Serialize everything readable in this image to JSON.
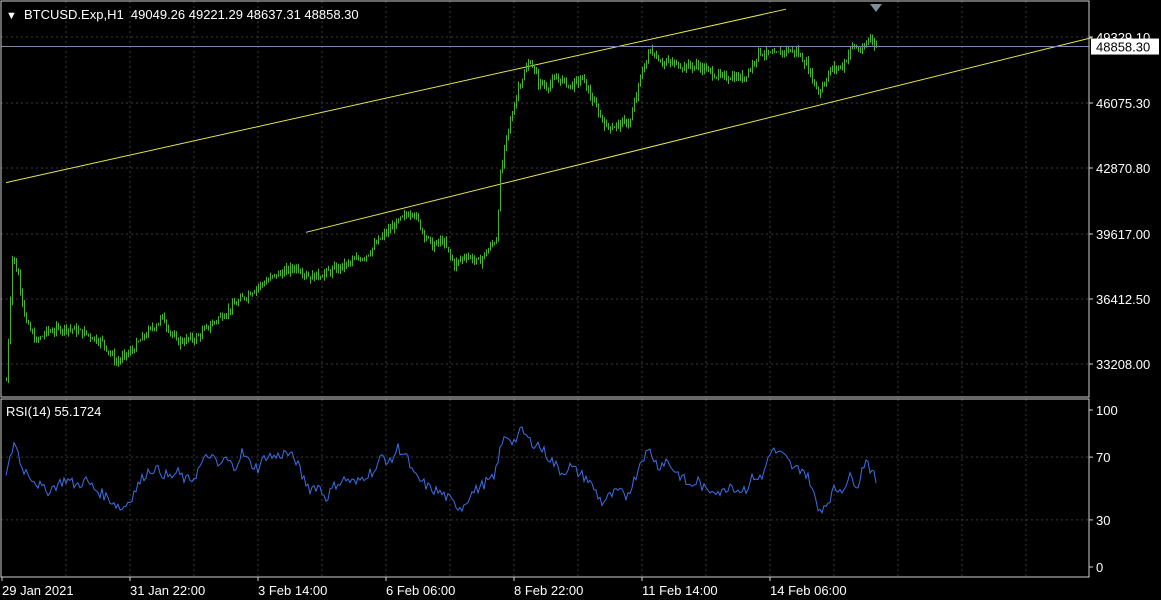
{
  "symbol_header": {
    "menu_glyph": "▼",
    "label": "BTCUSD.Exp,H1  49049.26 49221.29 48637.31 48858.30"
  },
  "indicator_header": {
    "label": "RSI(14) 55.1724"
  },
  "colors": {
    "background": "#000000",
    "grid": "#3a3a3a",
    "candle": "#4caf32",
    "channel": "#e6e64a",
    "rsi_line": "#3d6fe8",
    "price_line": "#7a8aa8",
    "current_price_box_bg": "#ffffff",
    "current_price_box_text": "#000000",
    "text": "#ffffff"
  },
  "chart_data": [
    {
      "type": "candlestick",
      "title": "BTCUSD.Exp,H1",
      "timeframe": "H1",
      "x_tick_labels": [
        "29 Jan 2021",
        "31 Jan 22:00",
        "3 Feb 14:00",
        "6 Feb 06:00",
        "8 Feb 22:00",
        "11 Feb 14:00",
        "14 Feb 06:00"
      ],
      "y_tick_labels": [
        "33208.00",
        "36412.50",
        "39617.00",
        "42870.80",
        "46075.30",
        "49329.10"
      ],
      "y_ticks": [
        33208.0,
        36412.5,
        39617.0,
        42870.8,
        46075.3,
        49329.1
      ],
      "ylim": [
        32000,
        50500
      ],
      "last_bar": {
        "open": 49049.26,
        "high": 49221.29,
        "low": 48637.31,
        "close": 48858.3
      },
      "current_price": 48858.3,
      "current_price_label": "48858.30",
      "close_path": [
        [
          0,
          32400
        ],
        [
          3,
          38500
        ],
        [
          6,
          37600
        ],
        [
          10,
          35200
        ],
        [
          15,
          34300
        ],
        [
          20,
          34800
        ],
        [
          30,
          35000
        ],
        [
          40,
          34700
        ],
        [
          48,
          34300
        ],
        [
          55,
          33300
        ],
        [
          62,
          33800
        ],
        [
          70,
          34700
        ],
        [
          78,
          35500
        ],
        [
          85,
          34300
        ],
        [
          95,
          34500
        ],
        [
          105,
          35400
        ],
        [
          115,
          36200
        ],
        [
          125,
          37000
        ],
        [
          135,
          37600
        ],
        [
          145,
          38000
        ],
        [
          152,
          37500
        ],
        [
          160,
          37700
        ],
        [
          170,
          38100
        ],
        [
          180,
          38600
        ],
        [
          190,
          39700
        ],
        [
          197,
          40300
        ],
        [
          203,
          40800
        ],
        [
          208,
          39800
        ],
        [
          213,
          39000
        ],
        [
          218,
          39300
        ],
        [
          224,
          38100
        ],
        [
          230,
          38600
        ],
        [
          236,
          38200
        ],
        [
          242,
          39000
        ],
        [
          245,
          39400
        ],
        [
          247,
          42500
        ],
        [
          250,
          44300
        ],
        [
          256,
          46900
        ],
        [
          262,
          48200
        ],
        [
          266,
          47100
        ],
        [
          270,
          46900
        ],
        [
          276,
          47300
        ],
        [
          282,
          46900
        ],
        [
          288,
          47300
        ],
        [
          294,
          46000
        ],
        [
          300,
          44900
        ],
        [
          306,
          45000
        ],
        [
          312,
          45200
        ],
        [
          318,
          47700
        ],
        [
          322,
          48700
        ],
        [
          328,
          48100
        ],
        [
          334,
          48000
        ],
        [
          340,
          47900
        ],
        [
          346,
          47900
        ],
        [
          352,
          47600
        ],
        [
          358,
          47300
        ],
        [
          362,
          47400
        ],
        [
          368,
          47300
        ],
        [
          372,
          47800
        ],
        [
          376,
          48600
        ],
        [
          384,
          48400
        ],
        [
          390,
          48700
        ],
        [
          395,
          48600
        ],
        [
          400,
          48000
        ],
        [
          406,
          46600
        ],
        [
          412,
          47700
        ],
        [
          418,
          47900
        ],
        [
          423,
          48900
        ],
        [
          428,
          48600
        ],
        [
          432,
          49400
        ],
        [
          435,
          48860
        ]
      ],
      "channel_lines": [
        {
          "name": "upper",
          "start": [
            0,
            42150
          ],
          "end": [
            390,
            50700
          ]
        },
        {
          "name": "lower",
          "start": [
            150,
            39700
          ],
          "end": [
            543,
            49300
          ]
        }
      ]
    },
    {
      "type": "line",
      "title": "RSI(14)",
      "series": [
        {
          "name": "RSI(14)",
          "last_value": 55.1724
        }
      ],
      "y_tick_labels": [
        "100",
        "70",
        "30",
        "0"
      ],
      "y_ticks": [
        100,
        70,
        30,
        0
      ],
      "levels": [
        70,
        30
      ],
      "ylim": [
        0,
        100
      ],
      "rsi_path": [
        [
          0,
          57
        ],
        [
          2,
          68
        ],
        [
          4,
          80
        ],
        [
          6,
          73
        ],
        [
          8,
          63
        ],
        [
          11,
          60
        ],
        [
          15,
          54
        ],
        [
          20,
          48
        ],
        [
          25,
          52
        ],
        [
          30,
          56
        ],
        [
          35,
          52
        ],
        [
          40,
          55
        ],
        [
          45,
          49
        ],
        [
          50,
          45
        ],
        [
          55,
          40
        ],
        [
          58,
          37
        ],
        [
          62,
          43
        ],
        [
          66,
          52
        ],
        [
          70,
          60
        ],
        [
          74,
          63
        ],
        [
          78,
          60
        ],
        [
          82,
          57
        ],
        [
          86,
          60
        ],
        [
          90,
          55
        ],
        [
          94,
          57
        ],
        [
          98,
          66
        ],
        [
          102,
          72
        ],
        [
          106,
          64
        ],
        [
          110,
          69
        ],
        [
          114,
          63
        ],
        [
          118,
          73
        ],
        [
          122,
          66
        ],
        [
          126,
          63
        ],
        [
          130,
          71
        ],
        [
          135,
          70
        ],
        [
          140,
          73
        ],
        [
          145,
          68
        ],
        [
          148,
          58
        ],
        [
          152,
          50
        ],
        [
          156,
          52
        ],
        [
          160,
          44
        ],
        [
          165,
          53
        ],
        [
          170,
          56
        ],
        [
          175,
          53
        ],
        [
          180,
          59
        ],
        [
          185,
          62
        ],
        [
          188,
          71
        ],
        [
          192,
          66
        ],
        [
          196,
          76
        ],
        [
          200,
          71
        ],
        [
          204,
          58
        ],
        [
          208,
          54
        ],
        [
          212,
          50
        ],
        [
          216,
          48
        ],
        [
          220,
          45
        ],
        [
          224,
          40
        ],
        [
          228,
          38
        ],
        [
          232,
          46
        ],
        [
          236,
          50
        ],
        [
          240,
          54
        ],
        [
          244,
          56
        ],
        [
          246,
          69
        ],
        [
          248,
          78
        ],
        [
          250,
          84
        ],
        [
          254,
          80
        ],
        [
          258,
          87
        ],
        [
          262,
          80
        ],
        [
          266,
          78
        ],
        [
          270,
          72
        ],
        [
          274,
          66
        ],
        [
          278,
          60
        ],
        [
          282,
          64
        ],
        [
          286,
          60
        ],
        [
          290,
          57
        ],
        [
          294,
          50
        ],
        [
          298,
          41
        ],
        [
          302,
          45
        ],
        [
          306,
          48
        ],
        [
          310,
          45
        ],
        [
          314,
          55
        ],
        [
          318,
          70
        ],
        [
          322,
          74
        ],
        [
          326,
          64
        ],
        [
          330,
          68
        ],
        [
          334,
          62
        ],
        [
          338,
          57
        ],
        [
          342,
          51
        ],
        [
          346,
          55
        ],
        [
          350,
          48
        ],
        [
          354,
          50
        ],
        [
          358,
          47
        ],
        [
          362,
          53
        ],
        [
          366,
          49
        ],
        [
          370,
          50
        ],
        [
          374,
          58
        ],
        [
          378,
          56
        ],
        [
          382,
          74
        ],
        [
          386,
          73
        ],
        [
          390,
          69
        ],
        [
          394,
          62
        ],
        [
          398,
          63
        ],
        [
          402,
          55
        ],
        [
          406,
          36
        ],
        [
          410,
          40
        ],
        [
          414,
          49
        ],
        [
          418,
          50
        ],
        [
          422,
          57
        ],
        [
          426,
          53
        ],
        [
          430,
          70
        ],
        [
          432,
          63
        ],
        [
          435,
          55
        ]
      ]
    }
  ]
}
